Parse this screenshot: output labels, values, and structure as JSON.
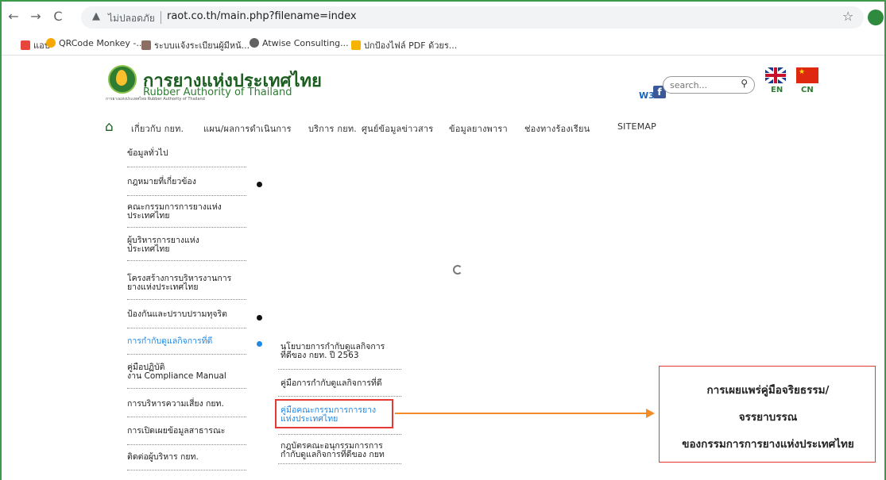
{
  "browser": {
    "nav_back": "←",
    "nav_forward": "→",
    "nav_reload": "C",
    "security_label": "ไม่ปลอดภัย",
    "url": "raot.co.th/main.php?filename=index",
    "star_icon": "star-icon",
    "bookmarks": [
      {
        "label": "แอป",
        "color": "#e8453c"
      },
      {
        "label": "QRCode Monkey -...",
        "color": "#f6a800"
      },
      {
        "label": "ระบบแจ้งระเบียนผู้มีหน้...",
        "color": "#8d6e63"
      },
      {
        "label": "Atwise Consulting...",
        "color": "#616161"
      },
      {
        "label": "ปกป้องไฟล์ PDF ด้วยร...",
        "color": "#f6b400"
      }
    ]
  },
  "site": {
    "logo_th": "การยางแห่งประเทศไทย",
    "logo_en": "Rubber Authority of Thailand",
    "logo_small": "การยางแห่งประเทศไทย Rubber Authority of Thailand",
    "w3c": "W3C",
    "facebook": "f",
    "search_placeholder": "search...",
    "lang_en": "EN",
    "lang_cn": "CN"
  },
  "nav": {
    "items": [
      "เกี่ยวกับ กยท.",
      "แผน/ผลการดำเนินการ",
      "บริการ กยท.",
      "ศูนย์ข้อมูลข่าวสาร",
      "ข้อมูลยางพารา",
      "ช่องทางร้องเรียน",
      "SITEMAP"
    ]
  },
  "left_menu": [
    {
      "line1": "ข้อมูลทั่วไป",
      "line2": ""
    },
    {
      "line1": "กฎหมายที่เกี่ยวข้อง",
      "line2": ""
    },
    {
      "line1": "คณะกรรมการการยางแห่ง",
      "line2": "ประเทศไทย"
    },
    {
      "line1": "ผู้บริหารการยางแห่ง",
      "line2": "ประเทศไทย"
    },
    {
      "line1": "โครงสร้างการบริหารงานการ",
      "line2": "ยางแห่งประเทศไทย"
    },
    {
      "line1": "ป้องกันและปราบปรามทุจริต",
      "line2": ""
    },
    {
      "line1": "การกำกับดูแลกิจการที่ดี",
      "line2": ""
    },
    {
      "line1": "คู่มือปฏิบัติ",
      "line2": "งาน Compliance Manual"
    },
    {
      "line1": "การบริหารความเสี่ยง กยท.",
      "line2": ""
    },
    {
      "line1": "การเปิดเผยข้อมูลสาธารณะ",
      "line2": ""
    },
    {
      "line1": "ติดต่อผู้บริหาร กยท.",
      "line2": ""
    }
  ],
  "submenu": [
    {
      "line1": "นโยบายการกำกับดูแลกิจการ",
      "line2": "ที่ดีของ กยท. ปี 2563"
    },
    {
      "line1": "คู่มือการกำกับดูแลกิจการที่ดี",
      "line2": ""
    },
    {
      "line1": "คู่มือคณะกรรมการการยาง",
      "line2": "แห่งประเทศไทย"
    },
    {
      "line1": "กฎบัตรคณะอนุกรรมการการ",
      "line2": "กำกับดูแลกิจการที่ดีของ กยท"
    }
  ],
  "callout": {
    "line1": "การเผยแพร่คู่มือจริยธรรม/",
    "line2": "จรรยาบรรณ",
    "line3": "ของกรรมการการยางแห่งประเทศไทย",
    "border_color": "#e53935",
    "arrow_color": "#f28c28"
  }
}
